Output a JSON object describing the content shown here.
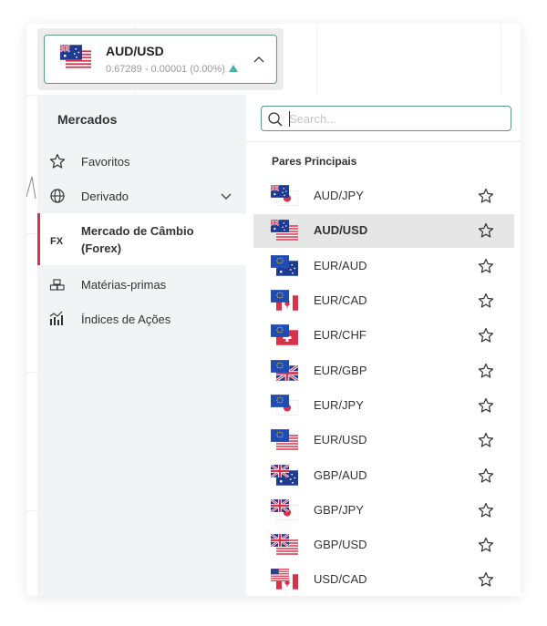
{
  "header": {
    "symbol": "AUD/USD",
    "quote": "0.67289 - 0.00001 (0.00%)",
    "flag_icon": "au-us-flag-icon",
    "trend": "up"
  },
  "left_panel": {
    "title": "Mercados",
    "categories": [
      {
        "label": "Favoritos",
        "icon": "star-icon"
      },
      {
        "label": "Derivado",
        "icon": "globe-icon"
      },
      {
        "label_line1": "Mercado de Câmbio",
        "label_line2": "(Forex)",
        "icon": "fx-icon",
        "active": true
      },
      {
        "label": "Matérias-primas",
        "icon": "gold-bars-icon"
      },
      {
        "label": "Índices de Ações",
        "icon": "stock-index-icon"
      }
    ]
  },
  "right_panel": {
    "search_placeholder": "Search...",
    "section_title": "Pares Principais",
    "pairs": [
      {
        "label": "AUD/JPY"
      },
      {
        "label": "AUD/USD",
        "selected": true
      },
      {
        "label": "EUR/AUD"
      },
      {
        "label": "EUR/CAD"
      },
      {
        "label": "EUR/CHF"
      },
      {
        "label": "EUR/GBP"
      },
      {
        "label": "EUR/JPY"
      },
      {
        "label": "EUR/USD"
      },
      {
        "label": "GBP/AUD"
      },
      {
        "label": "GBP/JPY"
      },
      {
        "label": "GBP/USD"
      },
      {
        "label": "USD/CAD"
      }
    ]
  },
  "colors": {
    "accent_border": "#5a9a86",
    "active_marker": "#d8324b",
    "up_triangle": "#4bb4a1"
  }
}
